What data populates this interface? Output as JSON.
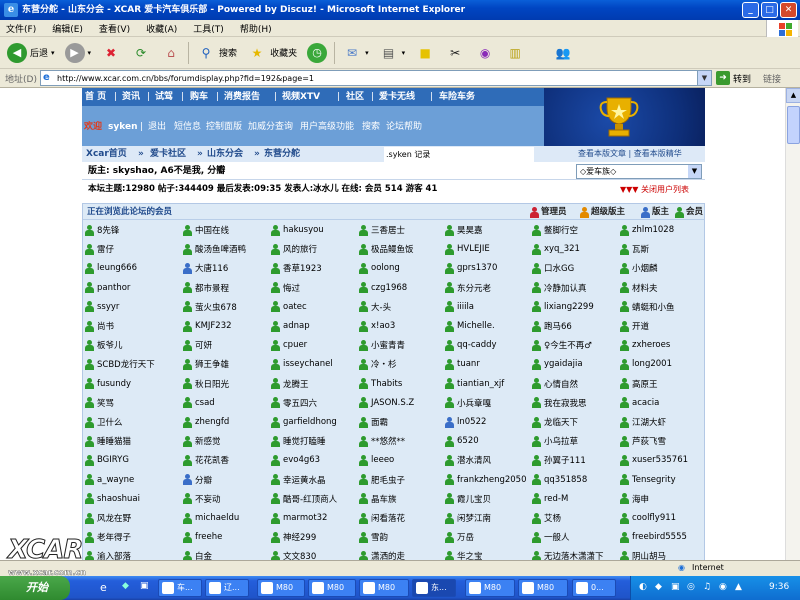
{
  "window": {
    "title": "东营分舵 - 山东分会 - XCAR 爱卡汽车俱乐部 - Powered by Discuz! - Microsoft Internet Explorer"
  },
  "menu": [
    "文件(F)",
    "编辑(E)",
    "查看(V)",
    "收藏(A)",
    "工具(T)",
    "帮助(H)"
  ],
  "toolbar": {
    "back": "后退",
    "search": "搜索",
    "favorites": "收藏夹"
  },
  "address": {
    "label": "地址(D)",
    "url": "http://www.xcar.com.cn/bbs/forumdisplay.php?fid=192&page=1",
    "go": "转到",
    "links": "链接"
  },
  "nav": {
    "items": [
      "首 页",
      "资讯",
      "试驾",
      "购车",
      "消费报告",
      "视频XTV",
      "社区",
      "爱卡无线",
      "车险车务"
    ]
  },
  "userbar": {
    "welcome": "欢迎",
    "username": "syken",
    "links": [
      "退出",
      "短信息",
      "控制面版",
      "加威分查询",
      "用户高级功能",
      "搜索",
      "论坛帮助"
    ]
  },
  "breadcrumb": {
    "items": [
      "Xcar首页",
      "爱卡社区",
      "山东分会",
      "东营分舵"
    ],
    "record": ".syken 记录",
    "right_links": [
      "查看本版文章",
      "查看本版精华"
    ]
  },
  "moderators": {
    "text": "版主: skyshao, A6不是我, 分瓣"
  },
  "forum_jump": {
    "selected": "◇爱车族◇"
  },
  "stats": {
    "text": "本坛主题:12980 帖子:344409 最后发表:09:35 发表人:冰水儿 在线: 会员 514 游客 41",
    "close_list": "关闭用户列表"
  },
  "online": {
    "title": "正在浏览此论坛的会员",
    "legend": [
      "管理员",
      "超级版主",
      "版主",
      "会员"
    ],
    "members": [
      [
        "8先锋",
        "中国在线",
        "hakusyou",
        "三香居士",
        "昊昊嘉",
        "鳖脚行空",
        "zhlm1028"
      ],
      [
        "雷仔",
        "酸汤鱼啤酒鸭",
        "风的旅行",
        "极品鳗鱼饭",
        "HVLEJIE",
        "xyq_321",
        "瓦斯"
      ],
      [
        "leung666",
        "大唐116",
        "香草1923",
        "oolong",
        "gprs1370",
        "口水GG",
        "小烟麟"
      ],
      [
        "panthor",
        "都市景程",
        "悔过",
        "czg1968",
        "东分元老",
        "冷静加认真",
        "材料夫"
      ],
      [
        "ssyyr",
        "萤火虫678",
        "oatec",
        "大-头",
        "iiiila",
        "lixiang2299",
        "蜻蜓和小鱼"
      ],
      [
        "尚书",
        "KMJF232",
        "adnap",
        "x!ao3",
        "Michelle.",
        "跑马66",
        "开道"
      ],
      [
        "板爷儿",
        "可妍",
        "cpuer",
        "小蜜青青",
        "qq-caddy",
        "♀今生不再♂",
        "zxheroes"
      ],
      [
        "SCBD龙行天下",
        "狮王争雄",
        "isseychanel",
        "冷・杉",
        "tuanr",
        "ygaidajia",
        "long2001"
      ],
      [
        "fusundy",
        "秋日阳光",
        "龙腾王",
        "Thabits",
        "tiantian_xjf",
        "心情自然",
        "高原王"
      ],
      [
        "笑骂",
        "csad",
        "零五四六",
        "JASON.S.Z",
        "小兵章嘎",
        "我在寂我思",
        "acacia"
      ],
      [
        "卫什么",
        "zhengfd",
        "garfieldhong",
        "面霸",
        "ln0522",
        "龙临天下",
        "江湖大虾"
      ],
      [
        "睡睡猫猫",
        "新感觉",
        "睡觉打瞌睡",
        "**悠然**",
        "6520",
        "小乌拉草",
        "芦荻飞雪"
      ],
      [
        "BGIRYG",
        "花花凯香",
        "evo4g63",
        "leeeo",
        "潜水清风",
        "孙翼子111",
        "xuser535761"
      ],
      [
        "a_wayne",
        "分瓣",
        "幸运黄水晶",
        "肥毛虫子",
        "frankzheng2050",
        "qq351858",
        "Tensegrity"
      ],
      [
        "shaoshuai",
        "不妄动",
        "酷哥-红顶商人",
        "晶车族",
        "霞儿宝贝",
        "red-M",
        "海申"
      ],
      [
        "风龙在野",
        "michaeldu",
        "marmot32",
        "闲看落花",
        "闲梦江南",
        "艾杨",
        "coolfly911"
      ],
      [
        "老年得子",
        "freehe",
        "神经299",
        "雪韵",
        "万岳",
        "一般人",
        "freebird5555"
      ],
      [
        "渝入部落",
        "白金",
        "文文830",
        "潇洒的走",
        "华之宝",
        "无边落木潇潇下",
        "阴山胡马"
      ]
    ]
  },
  "status": {
    "zone": "Internet"
  },
  "taskbar": {
    "start": "开始",
    "tasks": [
      "车...",
      "辽...",
      "东...",
      "M80",
      "M80",
      "M80",
      "M80",
      "M80",
      "0..."
    ],
    "clock": "9:36"
  },
  "watermark": {
    "logo": "XCAR",
    "site": "www.xcar.com.cn"
  },
  "colors": {
    "title_blue": "#0a5fd8",
    "nav_blue": "#2f6cb8",
    "panel_blue": "#ddeaf6",
    "member_green": "#2e9b2e",
    "super_blue": "#3a6ec8"
  }
}
